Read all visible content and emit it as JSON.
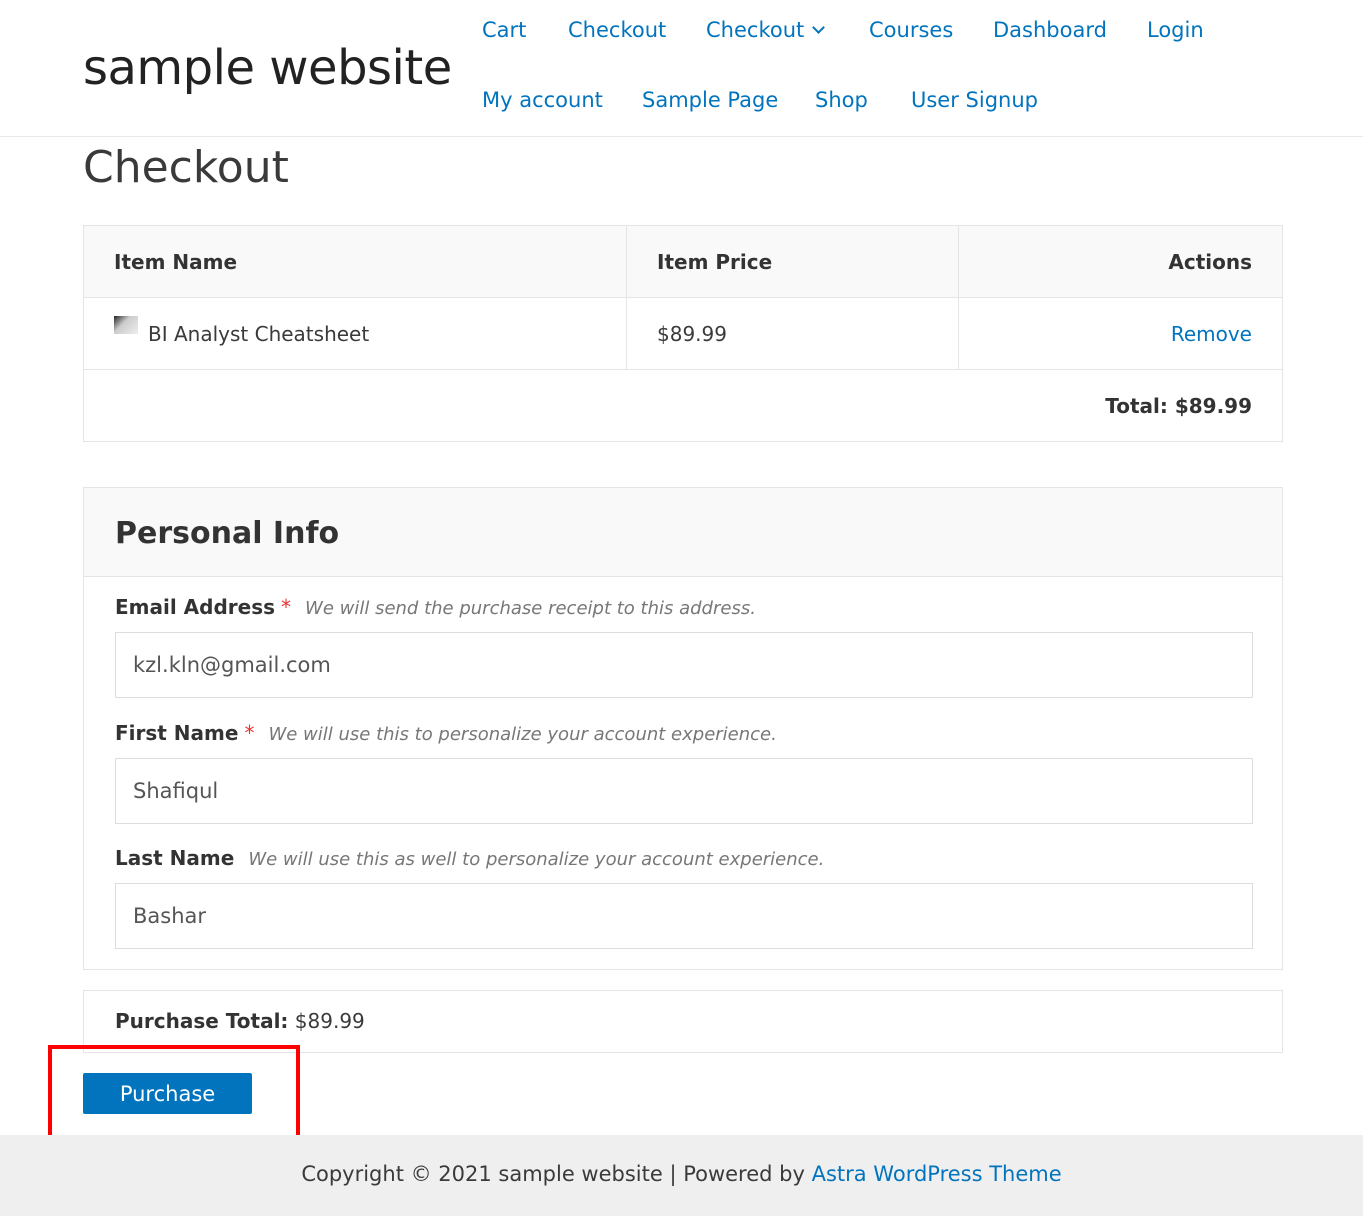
{
  "site": {
    "title": "sample website"
  },
  "nav": [
    {
      "label": "Cart"
    },
    {
      "label": "Checkout"
    },
    {
      "label": "Checkout"
    },
    {
      "label": "Courses"
    },
    {
      "label": "Dashboard"
    },
    {
      "label": "Login"
    },
    {
      "label": "My account"
    },
    {
      "label": "Sample Page"
    },
    {
      "label": "Shop"
    },
    {
      "label": "User Signup"
    }
  ],
  "page": {
    "title": "Checkout"
  },
  "cart": {
    "headers": [
      "Item Name",
      "Item Price",
      "Actions"
    ],
    "item": {
      "name": "BI Analyst Cheatsheet",
      "price": "$89.99",
      "action": "Remove"
    },
    "total": "Total: $89.99"
  },
  "personal": {
    "title": "Personal Info",
    "email": {
      "label": "Email Address",
      "required": "*",
      "hint": "We will send the purchase receipt to this address.",
      "value": "kzl.kln@gmail.com"
    },
    "first": {
      "label": "First Name",
      "required": "*",
      "hint": "We will use this to personalize your account experience.",
      "value": "Shafiqul"
    },
    "last": {
      "label": "Last Name",
      "hint": "We will use this as well to personalize your account experience.",
      "value": "Bashar"
    }
  },
  "purchase": {
    "total_label": "Purchase Total:",
    "total_value": "$89.99",
    "button": "Purchase"
  },
  "footer": {
    "text": "Copyright © 2021 sample website | Powered by ",
    "link": "Astra WordPress Theme"
  },
  "colors": {
    "accent": "#0274be",
    "highlight": "#ff0000"
  }
}
